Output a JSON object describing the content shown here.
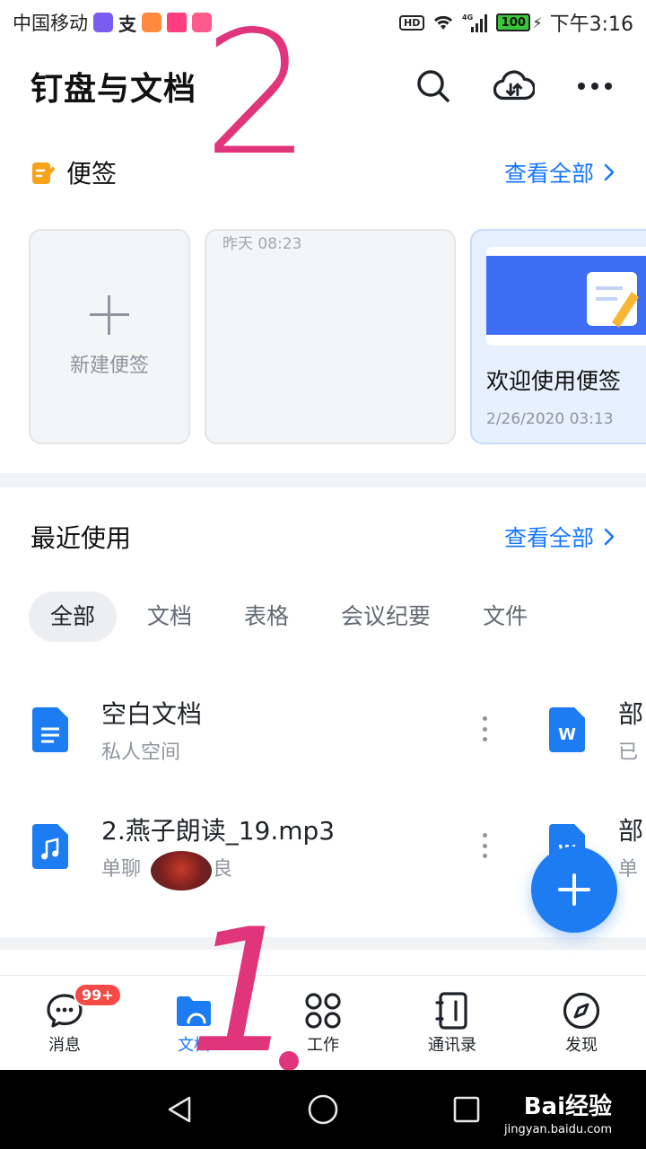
{
  "status_bar": {
    "carrier": "中国移动",
    "time": "下午3:16",
    "battery": "100",
    "network": "4G",
    "hd": "HD"
  },
  "header": {
    "title": "钉盘与文档",
    "icons": [
      "search-icon",
      "cloud-sync-icon",
      "more-icon"
    ]
  },
  "annotations": {
    "top": "2",
    "bottom": "1"
  },
  "notes": {
    "title": "便签",
    "view_all": "查看全部",
    "new_label": "新建便签",
    "card2_time": "昨天 08:23",
    "card3_title": "欢迎使用便签",
    "card3_date": "2/26/2020 03:13"
  },
  "recent": {
    "title": "最近使用",
    "view_all": "查看全部",
    "tabs": [
      "全部",
      "文档",
      "表格",
      "会议纪要",
      "文件"
    ],
    "files": [
      {
        "name": "空白文档",
        "sub": "私人空间",
        "icon": "doc-icon"
      },
      {
        "name": "2.燕子朗读_19.mp3",
        "sub": "单聊",
        "sub_suffix": "良",
        "icon": "music-icon"
      }
    ],
    "files_right": [
      {
        "name": "部",
        "sub": "已",
        "icon": "word-icon"
      },
      {
        "name": "部",
        "sub": "单",
        "icon": "word-icon"
      }
    ]
  },
  "bottom_nav": {
    "items": [
      {
        "label": "消息",
        "icon": "chat-icon",
        "badge": "99+"
      },
      {
        "label": "文档",
        "icon": "folder-icon"
      },
      {
        "label": "工作",
        "icon": "grid-icon"
      },
      {
        "label": "通讯录",
        "icon": "contacts-icon"
      },
      {
        "label": "发现",
        "icon": "compass-icon"
      }
    ]
  },
  "watermark": {
    "brand": "Bai经验",
    "url": "jingyan.baidu.com"
  },
  "colors": {
    "accent": "#1677ff",
    "fab": "#1e7cf2",
    "badge": "#f54a45",
    "annotation": "#e0357a"
  }
}
